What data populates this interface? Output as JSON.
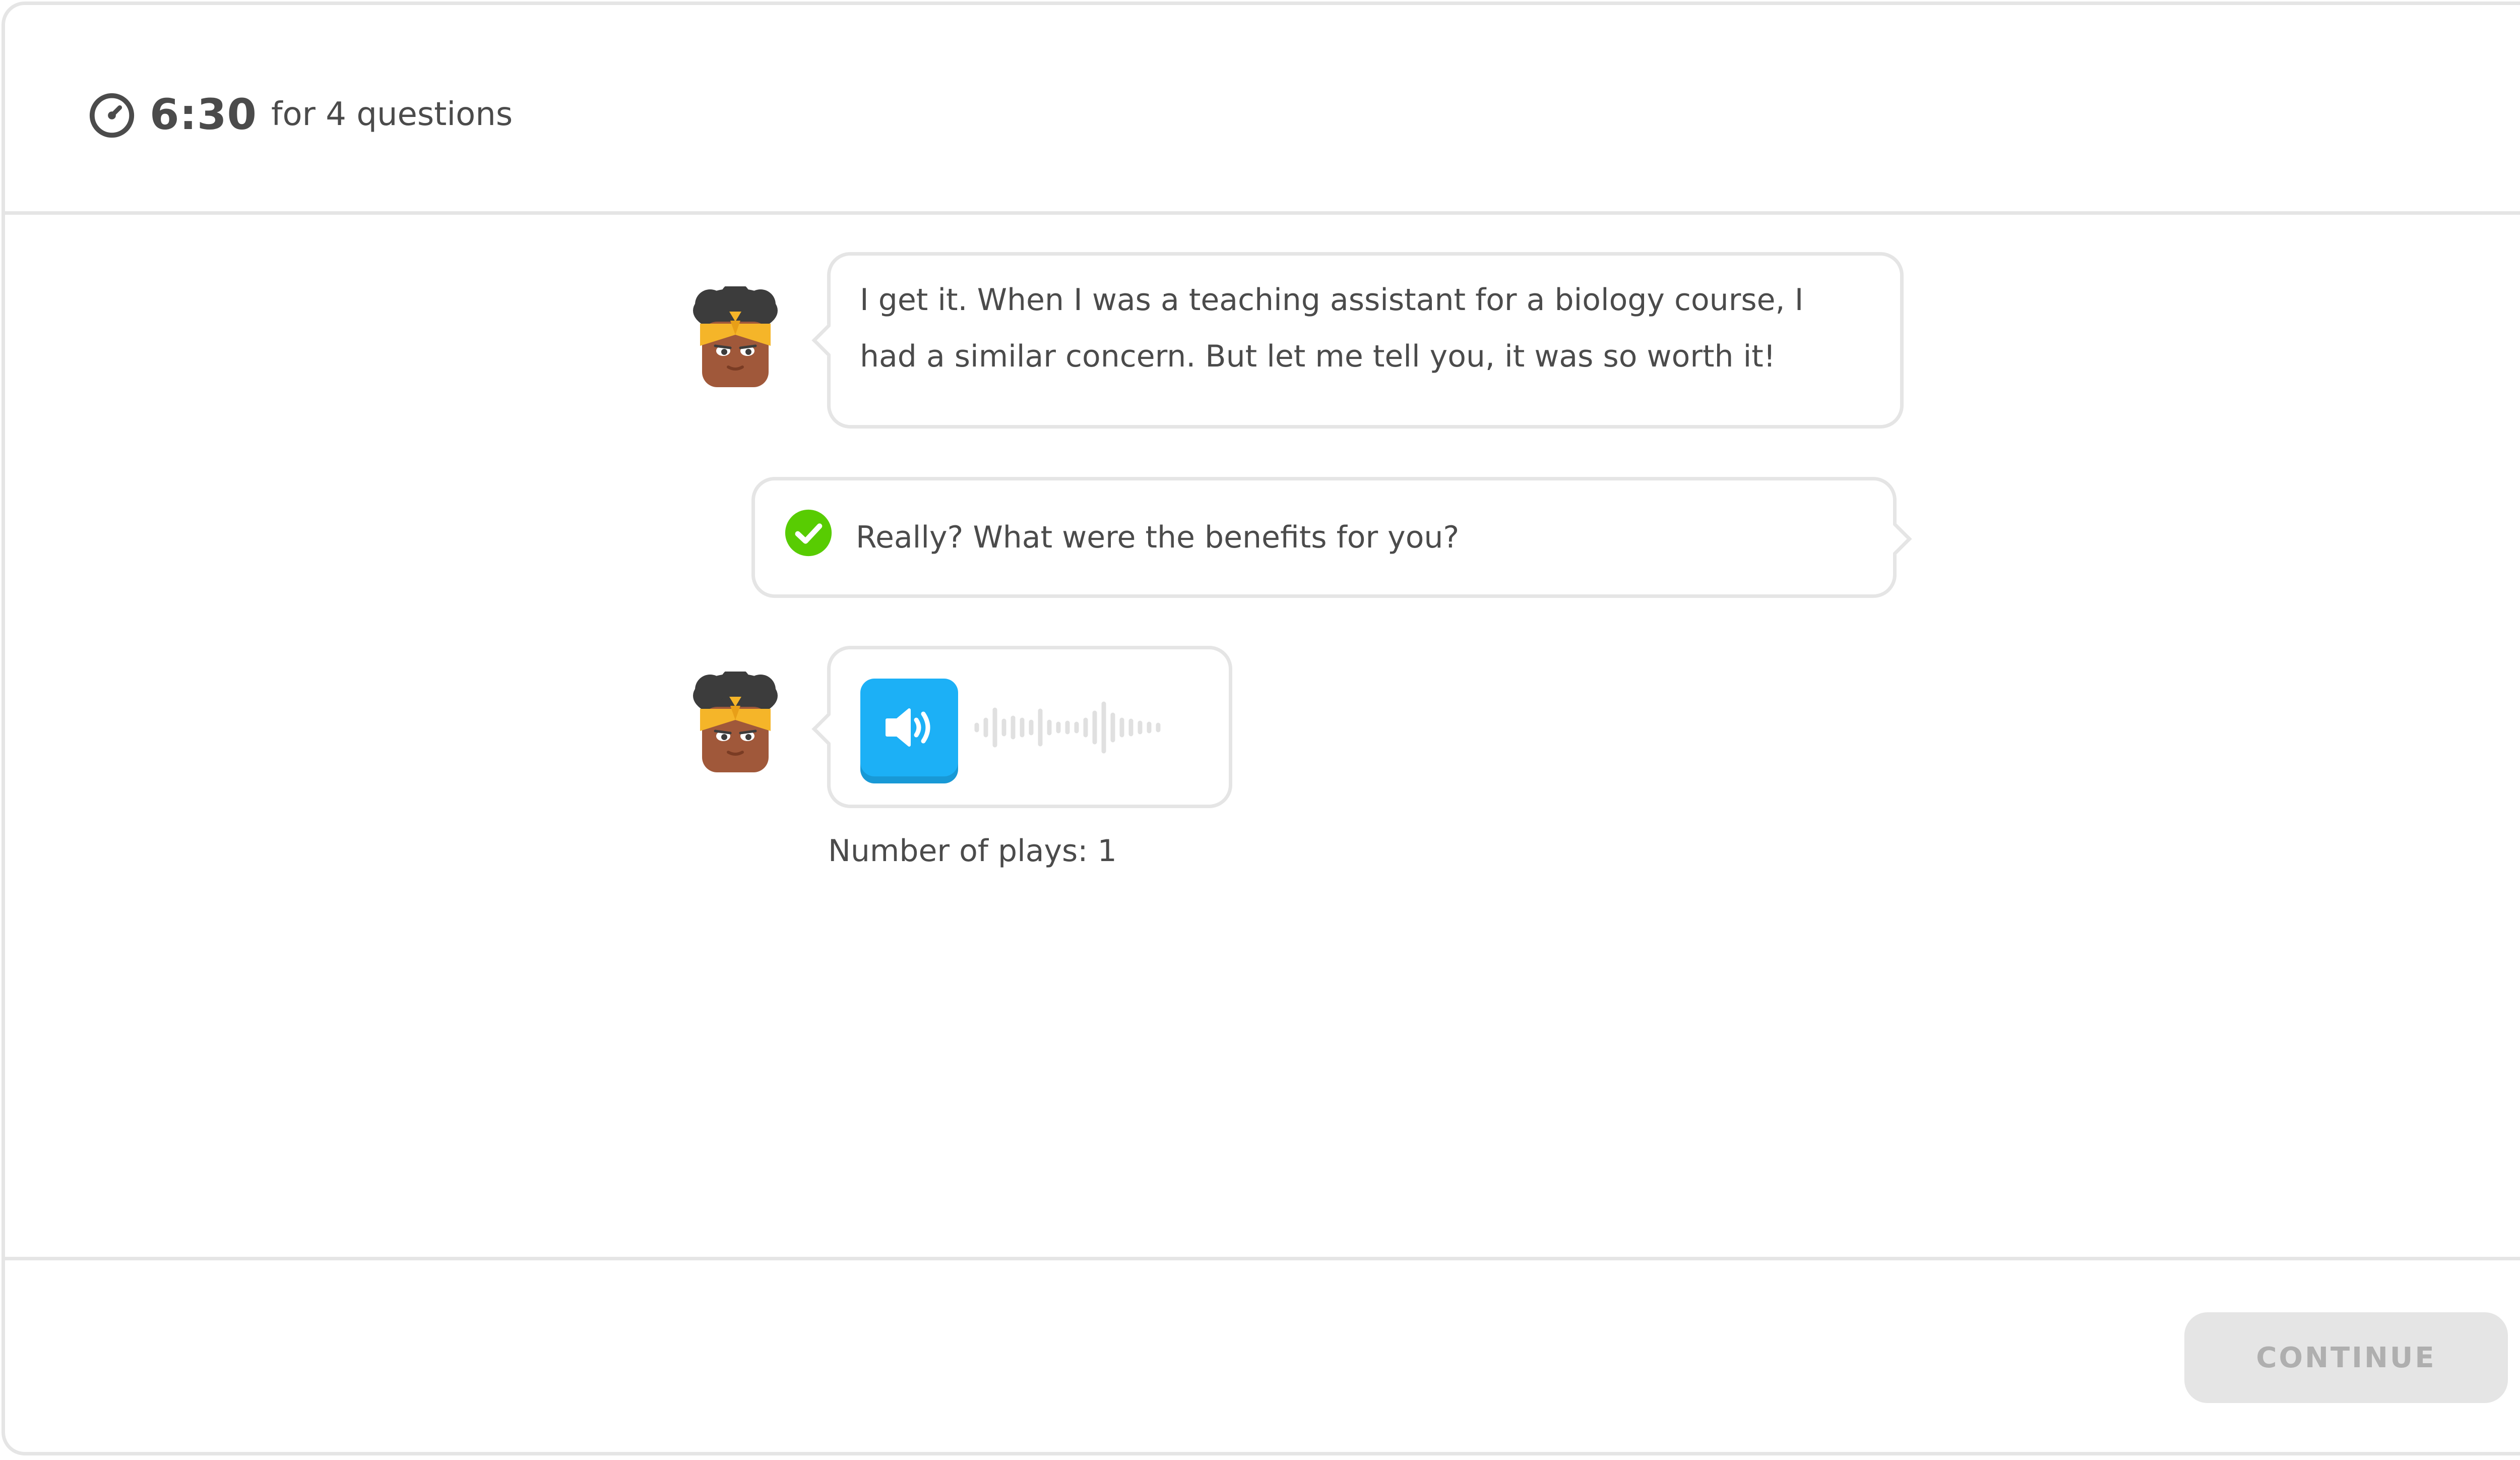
{
  "header": {
    "timer_value": "6:30",
    "timer_suffix": "for 4 questions",
    "timer_icon": "stopwatch-icon"
  },
  "conversation": {
    "message_1": {
      "speaker_icon": "character-avatar",
      "text": "I get it. When I was a teaching assistant for a biology course, I had a similar concern. But let me tell you, it was so worth it!"
    },
    "message_2": {
      "status_icon": "checkmark-icon",
      "text": "Really? What were the benefits for you?"
    },
    "message_3": {
      "speaker_icon": "character-avatar",
      "audio_button_icon": "speaker-icon",
      "waveform_icon": "waveform-icon"
    },
    "plays_text": "Number of plays: 1"
  },
  "footer": {
    "continue_label": "CONTINUE"
  },
  "colors": {
    "accent_blue": "#1cb0f6",
    "success_green": "#58cc02",
    "border_gray": "#e5e5e5",
    "text": "#4b4b4b",
    "disabled_text": "#afafaf"
  }
}
